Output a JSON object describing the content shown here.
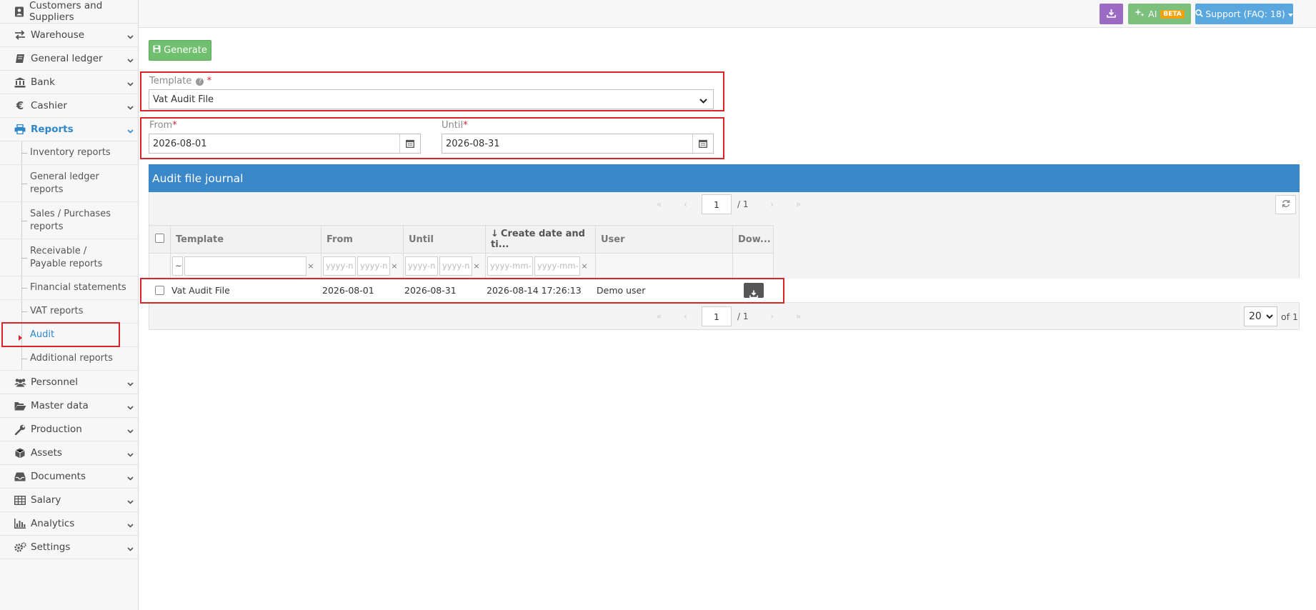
{
  "sidebar": {
    "items": [
      {
        "label": "Customers and Suppliers",
        "icon": "contact-card-icon"
      },
      {
        "label": "Warehouse",
        "icon": "exchange-arrows-icon"
      },
      {
        "label": "General ledger",
        "icon": "book-icon"
      },
      {
        "label": "Bank",
        "icon": "bank-icon"
      },
      {
        "label": "Cashier",
        "icon": "euro-icon"
      },
      {
        "label": "Reports",
        "icon": "printer-icon"
      },
      {
        "label": "Personnel",
        "icon": "users-icon"
      },
      {
        "label": "Master data",
        "icon": "folder-open-icon"
      },
      {
        "label": "Production",
        "icon": "wrench-icon"
      },
      {
        "label": "Assets",
        "icon": "cube-icon"
      },
      {
        "label": "Documents",
        "icon": "inbox-icon"
      },
      {
        "label": "Salary",
        "icon": "table-icon"
      },
      {
        "label": "Analytics",
        "icon": "bar-chart-icon"
      },
      {
        "label": "Settings",
        "icon": "gears-icon"
      }
    ],
    "reports_sub": [
      "Inventory reports",
      "General ledger reports",
      "Sales / Purchases reports",
      "Receivable / Payable reports",
      "Financial statements",
      "VAT reports",
      "Audit",
      "Additional reports"
    ]
  },
  "topbar": {
    "ai_label": "AI",
    "beta_label": "BETA",
    "support_label": "Support (FAQ: 18)",
    "download_color": "#9b6bc3",
    "ai_color": "#7dc07d",
    "support_color": "#5aa7e0"
  },
  "form": {
    "generate_label": "Generate",
    "template_label": "Template",
    "template_value": "Vat Audit File",
    "required_mark": "*",
    "from_label": "From",
    "from_value": "2026-08-01",
    "until_label": "Until",
    "until_value": "2026-08-31"
  },
  "journal": {
    "title": "Audit file journal",
    "page": "1",
    "total_pages": "/ 1",
    "page_size": "20",
    "of_label": "of 1",
    "columns": {
      "template": "Template",
      "from": "From",
      "until": "Until",
      "created": "Create date and ti...",
      "user": "User",
      "download": "Dow..."
    },
    "filters": {
      "tilde": "~",
      "date_placeholder_short": "yyyy-n",
      "datetime_placeholder": "yyyy-mm-",
      "clear": "×"
    },
    "rows": [
      {
        "template": "Vat Audit File",
        "from": "2026-08-01",
        "until": "2026-08-31",
        "created": "2026-08-14 17:26:13",
        "user": "Demo user"
      }
    ]
  }
}
